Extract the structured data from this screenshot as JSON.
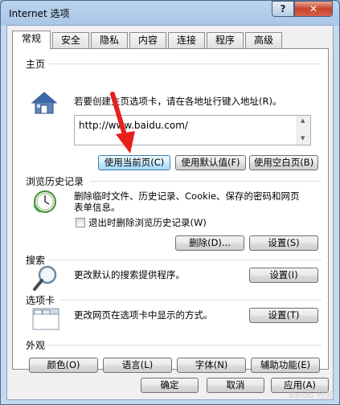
{
  "window": {
    "title": "Internet 选项",
    "help_label": "?",
    "close_label": "✕"
  },
  "tabs": [
    {
      "label": "常规",
      "active": true
    },
    {
      "label": "安全"
    },
    {
      "label": "隐私"
    },
    {
      "label": "内容"
    },
    {
      "label": "连接"
    },
    {
      "label": "程序"
    },
    {
      "label": "高级"
    }
  ],
  "home": {
    "title": "主页",
    "desc": "若要创建主页选项卡，请在各地址行键入地址(R)。",
    "url": "http://www.baidu.com/",
    "btn_current": "使用当前页(C)",
    "btn_default": "使用默认值(F)",
    "btn_blank": "使用空白页(B)"
  },
  "history": {
    "title": "浏览历史记录",
    "desc_line1": "删除临时文件、历史记录、Cookie、保存的密码和网页",
    "desc_line2": "表单信息。",
    "checkbox_label": "退出时删除浏览历史记录(W)",
    "checkbox_checked": false,
    "btn_delete": "删除(D)...",
    "btn_settings": "设置(S)"
  },
  "search": {
    "title": "搜索",
    "desc": "更改默认的搜索提供程序。",
    "btn_settings": "设置(I)"
  },
  "tabs_section": {
    "title": "选项卡",
    "desc": "更改网页在选项卡中显示的方式。",
    "btn_settings": "设置(T)"
  },
  "appearance": {
    "title": "外观",
    "btn_colors": "颜色(O)",
    "btn_languages": "语言(L)",
    "btn_fonts": "字体(N)",
    "btn_accessibility": "辅助功能(E)"
  },
  "footer": {
    "ok": "确定",
    "cancel": "取消",
    "apply": "应用(A)"
  },
  "watermark": "Baidu 经验",
  "colors": {
    "annotation_arrow": "#e8201c"
  }
}
